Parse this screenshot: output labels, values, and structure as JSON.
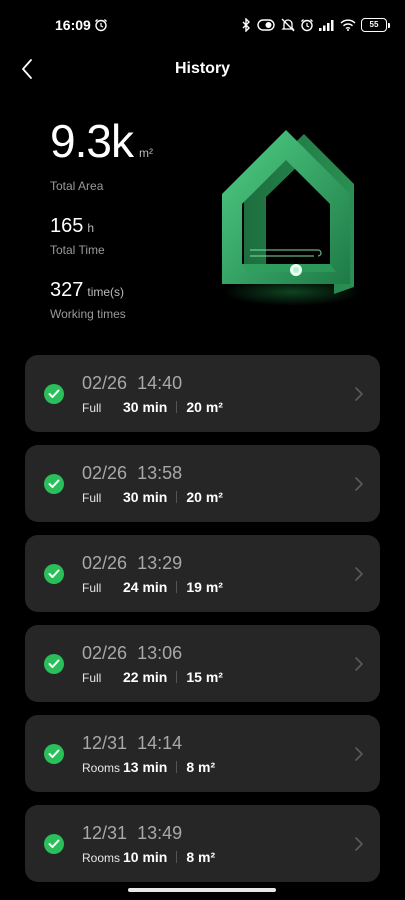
{
  "status_bar": {
    "time": "16:09",
    "battery": "55",
    "icons": [
      "alarm-icon",
      "bluetooth-icon",
      "vibrate-icon",
      "mute-icon",
      "alarm-icon",
      "signal-icon",
      "wifi-icon",
      "battery-icon"
    ]
  },
  "header": {
    "title": "History",
    "back_icon": "back-chevron-icon"
  },
  "stats": {
    "total_area": {
      "value": "9.3k",
      "unit": "m²",
      "label": "Total Area"
    },
    "total_time": {
      "value": "165",
      "unit": "h",
      "label": "Total Time"
    },
    "working_times": {
      "value": "327",
      "unit": "time(s)",
      "label": "Working times"
    }
  },
  "history": [
    {
      "date": "02/26",
      "time": "14:40",
      "mode": "Full",
      "duration": "30 min",
      "area": "20 m²"
    },
    {
      "date": "02/26",
      "time": "13:58",
      "mode": "Full",
      "duration": "30 min",
      "area": "20 m²"
    },
    {
      "date": "02/26",
      "time": "13:29",
      "mode": "Full",
      "duration": "24 min",
      "area": "19 m²"
    },
    {
      "date": "02/26",
      "time": "13:06",
      "mode": "Full",
      "duration": "22 min",
      "area": "15 m²"
    },
    {
      "date": "12/31",
      "time": "14:14",
      "mode": "Rooms",
      "duration": "13 min",
      "area": "8 m²"
    },
    {
      "date": "12/31",
      "time": "13:49",
      "mode": "Rooms",
      "duration": "10 min",
      "area": "8 m²"
    }
  ],
  "colors": {
    "background": "#000000",
    "card": "#262626",
    "success": "#2bbf5c",
    "accent_green": "#35a865"
  }
}
